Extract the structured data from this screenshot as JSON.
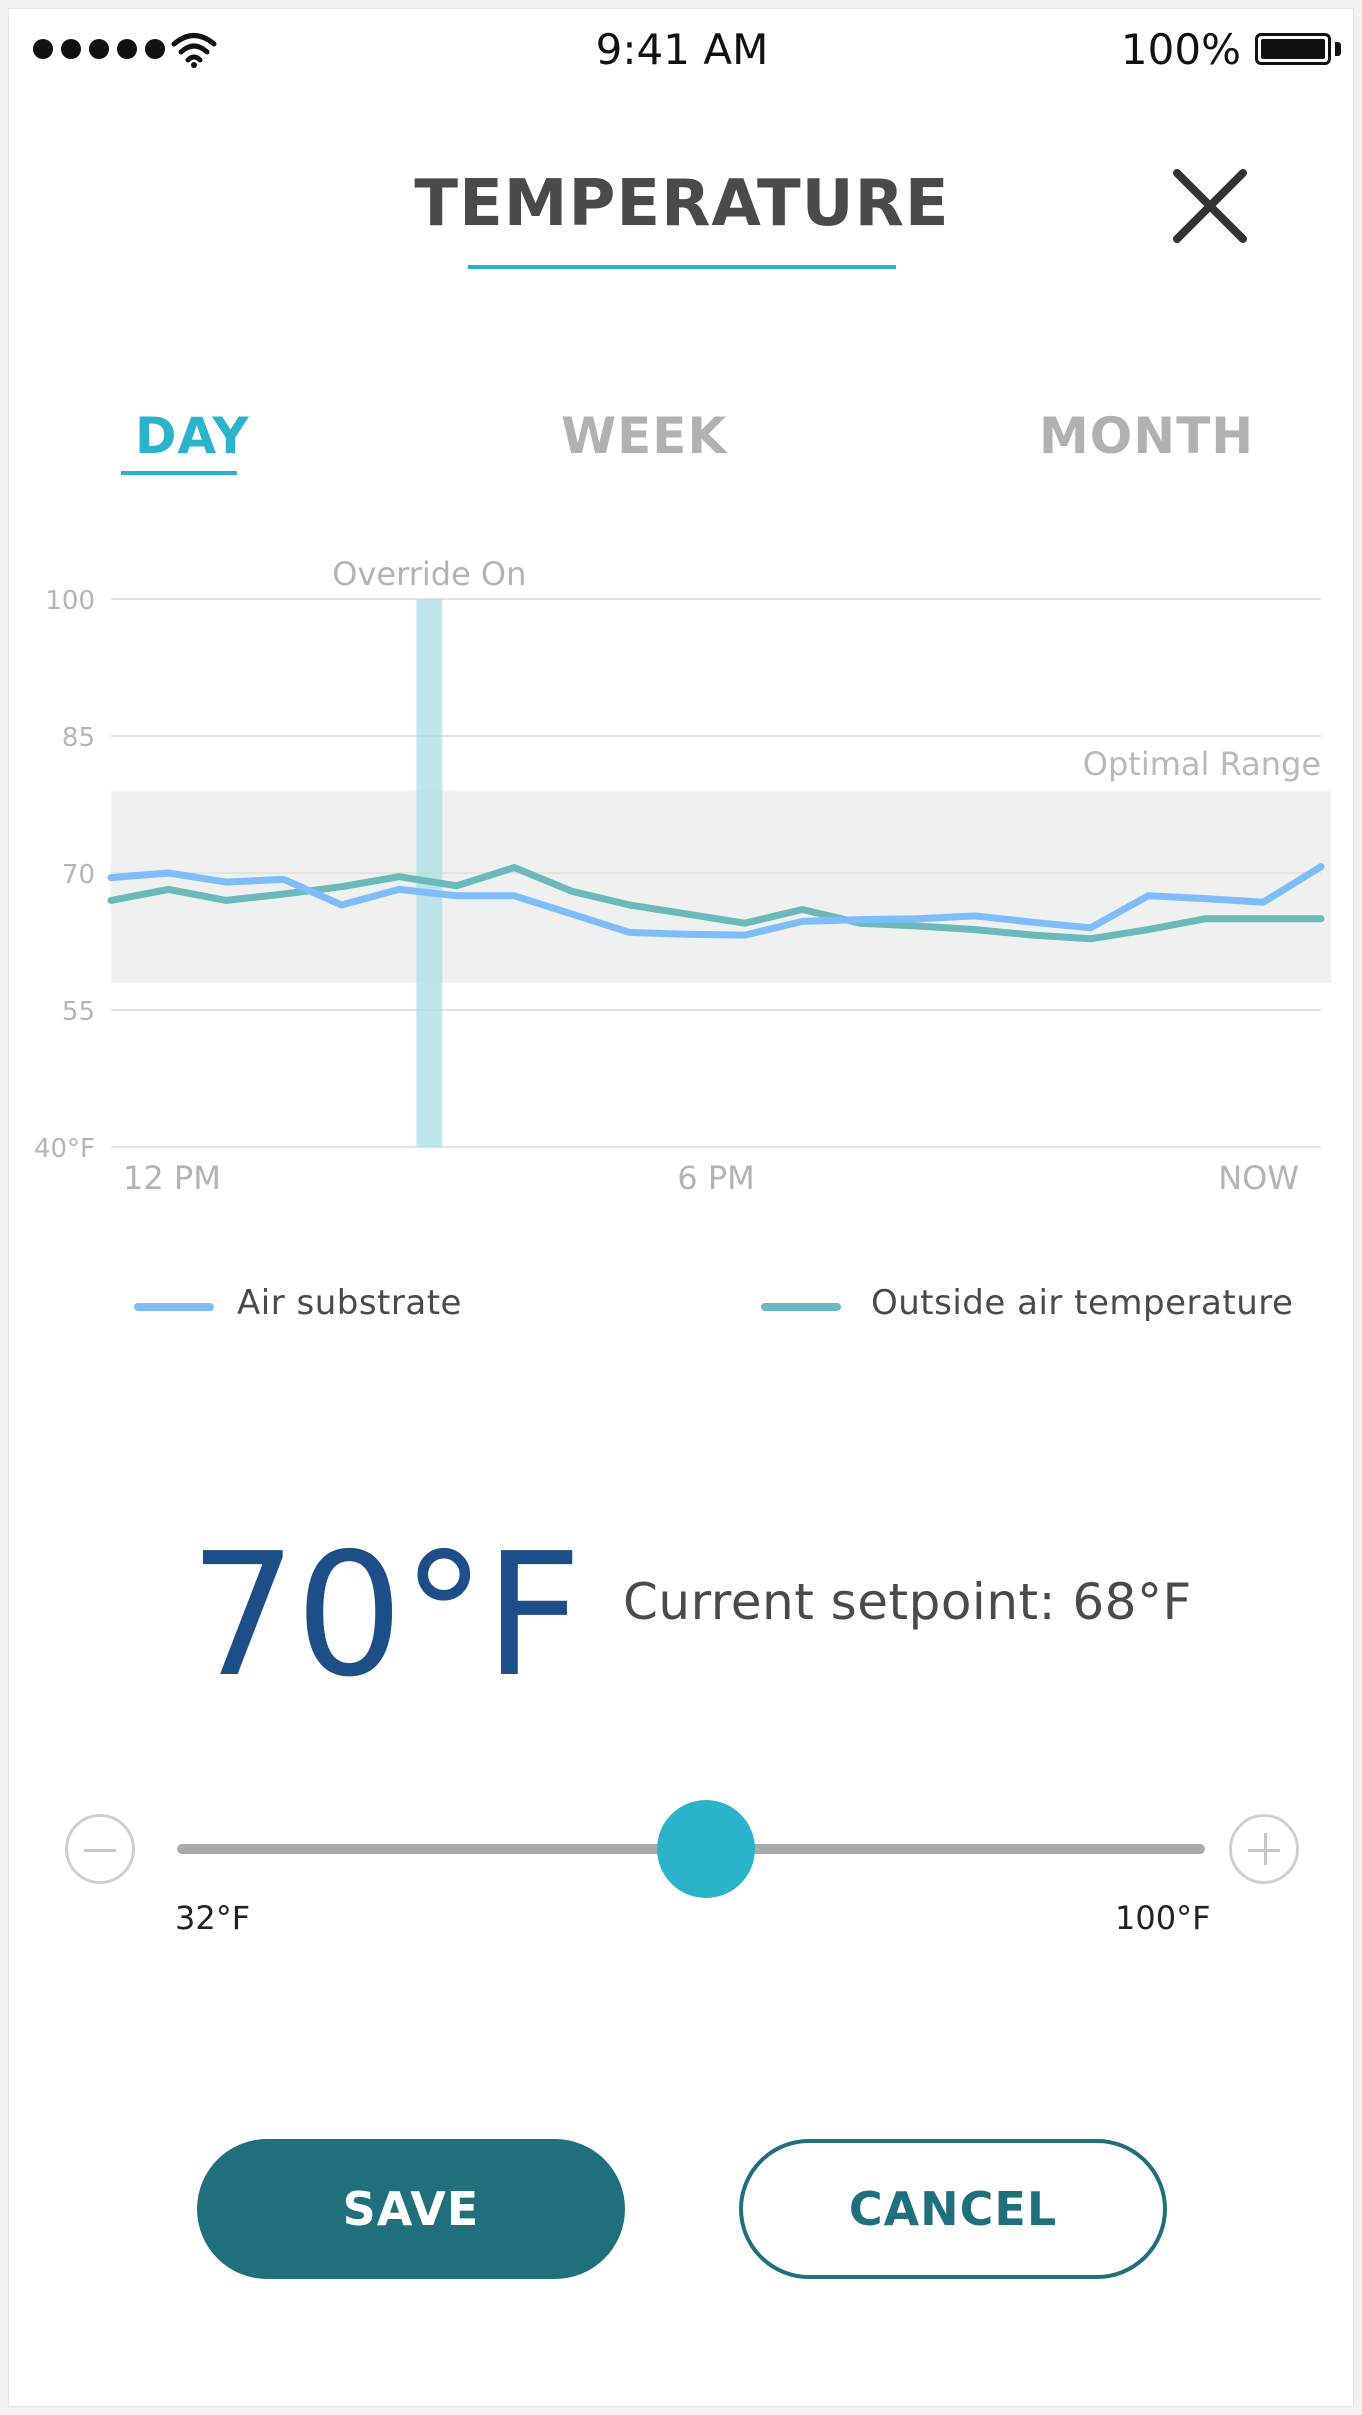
{
  "status_bar": {
    "signal_icon": "signal-dots-icon",
    "wifi_icon": "wifi-icon",
    "time": "9:41 AM",
    "battery_percent": "100%",
    "battery_icon": "battery-icon"
  },
  "header": {
    "title": "TEMPERATURE",
    "close_icon": "close-icon"
  },
  "tabs": [
    {
      "label": "DAY",
      "active": true
    },
    {
      "label": "WEEK",
      "active": false
    },
    {
      "label": "MONTH",
      "active": false
    }
  ],
  "colors": {
    "accent": "#2bb3cc",
    "title_text": "#4a4a4a",
    "big_temp": "#1d4e87",
    "button_primary": "#1f6f7d",
    "series_air_substrate": "#7fbdfa",
    "series_outside_air": "#6bb8bd",
    "optimal_range_fill": "#eef1f0",
    "override_band": "#a9dde6"
  },
  "chart_data": {
    "type": "line",
    "x": [
      0,
      1,
      2,
      3,
      4,
      5,
      6,
      7,
      8,
      9,
      10,
      11,
      12,
      13,
      14,
      15,
      16,
      17,
      18,
      19,
      20,
      21
    ],
    "x_ticks": [
      {
        "pos": 0,
        "label": "12 PM"
      },
      {
        "pos": 10.5,
        "label": "6 PM"
      },
      {
        "pos": 21,
        "label": "NOW"
      }
    ],
    "y_ticks": [
      {
        "value": 100,
        "label": "100"
      },
      {
        "value": 85,
        "label": "85"
      },
      {
        "value": 70,
        "label": "70"
      },
      {
        "value": 55,
        "label": "55"
      },
      {
        "value": 40,
        "label": "40°F"
      }
    ],
    "ylim": [
      40,
      100
    ],
    "xlim": [
      0,
      21
    ],
    "grid": true,
    "series": [
      {
        "name": "Air substrate",
        "values": [
          69.5,
          70,
          69,
          69.3,
          66.5,
          68.2,
          67.5,
          67.5,
          65.5,
          63.5,
          63.3,
          63.2,
          64.7,
          64.9,
          65.0,
          65.3,
          64.6,
          64.0,
          67.5,
          67.2,
          66.8,
          70.7
        ]
      },
      {
        "name": "Outside air temperature",
        "values": [
          67,
          68.2,
          67,
          67.7,
          68.5,
          69.6,
          68.6,
          70.6,
          68,
          66.5,
          65.5,
          64.5,
          66,
          64.5,
          64.2,
          63.8,
          63.2,
          62.8,
          63.8,
          65,
          65,
          65
        ]
      }
    ],
    "annotations": {
      "override": {
        "label": "Override On",
        "x_start": 5.3,
        "x_end": 5.75
      },
      "optimal_range": {
        "label": "Optimal Range",
        "y_min": 58,
        "y_max": 79
      }
    }
  },
  "legend": [
    {
      "label": "Air substrate"
    },
    {
      "label": "Outside air temperature"
    }
  ],
  "current": {
    "temperature": "70°F",
    "setpoint_text": "Current setpoint: 68°F"
  },
  "slider": {
    "min_label": "32°F",
    "max_label": "100°F",
    "min": 32,
    "max": 100,
    "value": 67,
    "minus_icon": "minus-circle-icon",
    "plus_icon": "plus-circle-icon"
  },
  "actions": {
    "save_label": "SAVE",
    "cancel_label": "CANCEL"
  }
}
